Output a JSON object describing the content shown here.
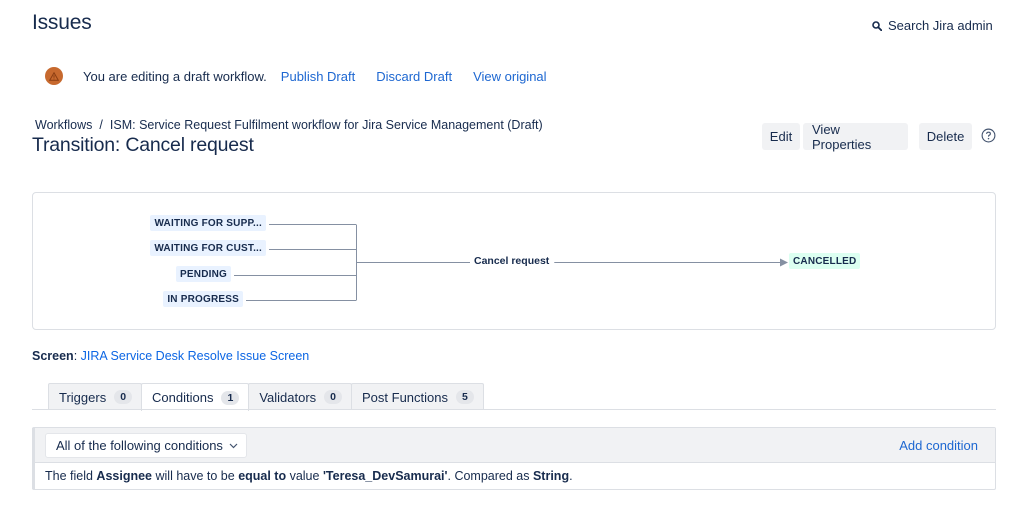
{
  "header": {
    "title": "Issues",
    "search_label": "Search Jira admin",
    "search_icon": "search-icon"
  },
  "draft_bar": {
    "icon": "warning-icon",
    "message": "You are editing a draft workflow.",
    "links": [
      "Publish Draft",
      "Discard Draft",
      "View original"
    ]
  },
  "breadcrumb": {
    "items": [
      "Workflows",
      "ISM: Service Request Fulfilment workflow for Jira Service Management (Draft)"
    ],
    "separator": "/"
  },
  "page": {
    "title": "Transition: Cancel request"
  },
  "actions": {
    "edit": "Edit",
    "view_properties": "View Properties",
    "delete": "Delete",
    "help_icon": "help-icon"
  },
  "diagram": {
    "from_statuses": [
      "WAITING FOR SUPP...",
      "WAITING FOR CUST...",
      "PENDING",
      "IN PROGRESS"
    ],
    "transition": "Cancel request",
    "to_status": "CANCELLED",
    "colors": {
      "from_bg": "#e9f2ff",
      "to_bg": "#dcfff1",
      "line": "#8590a2"
    }
  },
  "screen": {
    "label": "Screen",
    "value": "JIRA Service Desk Resolve Issue Screen"
  },
  "tabs": [
    {
      "label": "Triggers",
      "count": "0",
      "active": false
    },
    {
      "label": "Conditions",
      "count": "1",
      "active": true
    },
    {
      "label": "Validators",
      "count": "0",
      "active": false
    },
    {
      "label": "Post Functions",
      "count": "5",
      "active": false
    }
  ],
  "conditions": {
    "selector_value": "All of the following conditions",
    "add_label": "Add condition",
    "rule": {
      "p1": "The field ",
      "field": "Assignee",
      "p2": " will have to be ",
      "operator": "equal to",
      "p3": " value ",
      "value": "'Teresa_DevSamurai'",
      "p4": ". Compared as ",
      "type": "String",
      "p5": "."
    }
  },
  "colors": {
    "link": "#1d67d1",
    "text": "#172b4d",
    "warning": "#c7692e"
  }
}
